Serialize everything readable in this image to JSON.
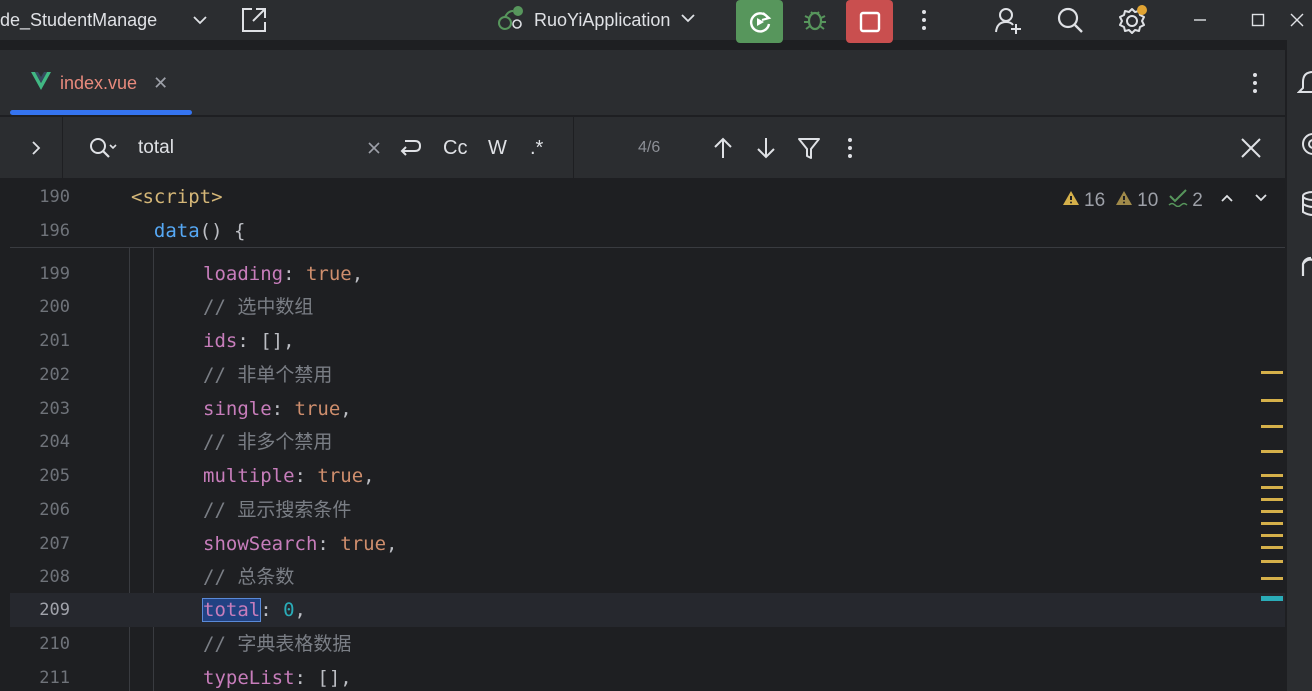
{
  "title_bar": {
    "project_name": "de_StudentManage",
    "run_config": "RuoYiApplication"
  },
  "tabs": [
    {
      "label": "index.vue",
      "language": "vue"
    }
  ],
  "find": {
    "query": "total",
    "match_case_label": "Cc",
    "words_label": "W",
    "regex_label": ".*",
    "match_count": "4/6"
  },
  "inspections": {
    "warnings": "16",
    "weak_warnings": "10",
    "typos": "2"
  },
  "sticky_lines": [
    {
      "num": "190",
      "code": "<script>"
    },
    {
      "num": "196",
      "code": "  data() {"
    }
  ],
  "lines": [
    {
      "num": "199",
      "key": "loading",
      "value": "true",
      "suffix": ","
    },
    {
      "num": "200",
      "comment": "// 选中数组"
    },
    {
      "num": "201",
      "key": "ids",
      "value": "[]",
      "suffix": ","
    },
    {
      "num": "202",
      "comment": "// 非单个禁用"
    },
    {
      "num": "203",
      "key": "single",
      "value": "true",
      "suffix": ","
    },
    {
      "num": "204",
      "comment": "// 非多个禁用"
    },
    {
      "num": "205",
      "key": "multiple",
      "value": "true",
      "suffix": ","
    },
    {
      "num": "206",
      "comment": "// 显示搜索条件"
    },
    {
      "num": "207",
      "key": "showSearch",
      "value": "true",
      "suffix": ","
    },
    {
      "num": "208",
      "comment": "// 总条数"
    },
    {
      "num": "209",
      "key": "total",
      "value": "0",
      "suffix": ",",
      "current": true
    },
    {
      "num": "210",
      "comment": "// 字典表格数据"
    },
    {
      "num": "211",
      "key": "typeList",
      "value": "[]",
      "suffix": ","
    }
  ],
  "colors": {
    "accent": "#3574f0",
    "run": "#57965c",
    "stop": "#c94f4f",
    "warning": "#d5b04a"
  }
}
